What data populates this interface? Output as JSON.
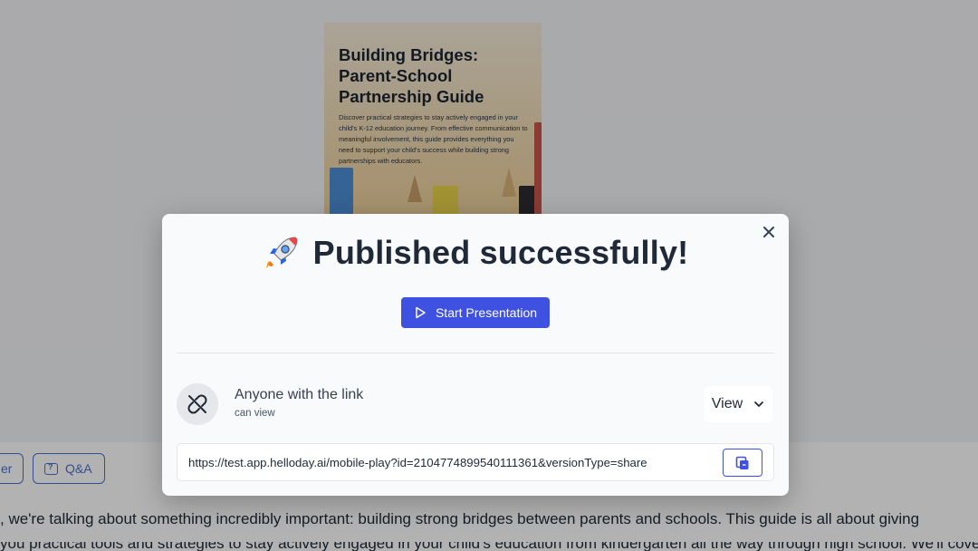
{
  "cover": {
    "title": "Building Bridges: Parent-School Partnership Guide",
    "description": "Discover practical strategies to stay actively engaged in your child's K-12 education journey. From effective communication to meaningful involvement, this guide provides everything you need to support your child's success while building strong partnerships with educators."
  },
  "toolbar": {
    "left_pill_label": "er",
    "qa_label": "Q&A"
  },
  "transcript": {
    "line1": ", we're talking about something incredibly important: building strong bridges between parents and schools. This guide is all about giving",
    "line2": "you practical tools and strategies to stay actively engaged in your child's education from kindergarten all the way through high school. We'll cover everything from"
  },
  "dialog": {
    "heading": "Published successfully!",
    "start_button_label": "Start Presentation",
    "access_title": "Anyone with the link",
    "access_subtitle": "can view",
    "permission_value": "View",
    "share_url": "https://test.app.helloday.ai/mobile-play?id=2104774899540111361&versionType=share"
  },
  "colors": {
    "accent": "#3f51e0",
    "overlay": "rgba(0,0,0,0.30)",
    "dialog_bg": "#f8fafc"
  },
  "icons": {
    "close": "close-icon",
    "rocket": "rocket-icon",
    "play": "play-icon",
    "link": "unlink-icon",
    "chevron": "chevron-down-icon",
    "copy": "copy-icon",
    "qa": "qa-icon"
  }
}
